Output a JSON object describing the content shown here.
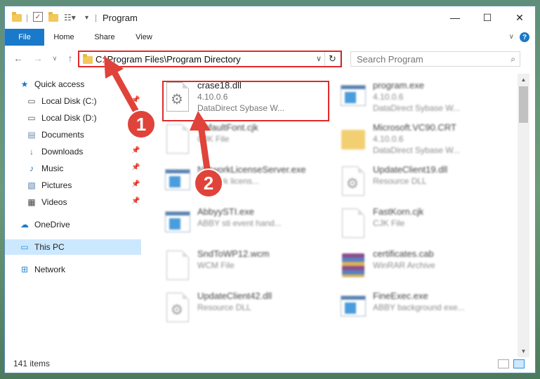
{
  "window": {
    "title": "Program",
    "controls": {
      "minimize": "—",
      "maximize": "☐",
      "close": "✕"
    }
  },
  "ribbon": {
    "tabs": [
      "File",
      "Home",
      "Share",
      "View"
    ],
    "help": "?"
  },
  "address": {
    "path": "C:\\Program Files\\Program Directory"
  },
  "search": {
    "placeholder": "Search Program"
  },
  "sidebar": {
    "items": [
      {
        "label": "Quick access",
        "icon": "star-icon"
      },
      {
        "label": "Local Disk (C:)",
        "icon": "drive-icon",
        "pinned": true
      },
      {
        "label": "Local Disk (D:)",
        "icon": "drive-icon"
      },
      {
        "label": "Documents",
        "icon": "documents-icon",
        "pinned": true
      },
      {
        "label": "Downloads",
        "icon": "download-icon",
        "pinned": true
      },
      {
        "label": "Music",
        "icon": "music-icon",
        "pinned": true
      },
      {
        "label": "Pictures",
        "icon": "pictures-icon",
        "pinned": true
      },
      {
        "label": "Videos",
        "icon": "videos-icon",
        "pinned": true
      },
      {
        "label": "OneDrive",
        "icon": "cloud-icon"
      },
      {
        "label": "This PC",
        "icon": "computer-icon",
        "selected": true
      },
      {
        "label": "Network",
        "icon": "network-icon"
      }
    ]
  },
  "files": [
    {
      "name": "crase18.dll",
      "line2": "4.10.0.6",
      "line3": "DataDirect Sybase W...",
      "icon": "dll-icon",
      "highlighted": true
    },
    {
      "name": "program.exe",
      "line2": "4.10.0.6",
      "line3": "DataDirect Sybase W...",
      "icon": "exe-icon"
    },
    {
      "name": "DefaultFont.cjk",
      "line2": "CJK File",
      "line3": "",
      "icon": "file-icon"
    },
    {
      "name": "Microsoft.VC90.CRT",
      "line2": "4.10.0.6",
      "line3": "DataDirect Sybase W...",
      "icon": "folder-icon"
    },
    {
      "name": "NetworkLicenseServer.exe",
      "line2": "Network licens...",
      "line3": "",
      "icon": "exe-icon"
    },
    {
      "name": "UpdateClient19.dll",
      "line2": "Resource DLL",
      "line3": "",
      "icon": "dll-icon"
    },
    {
      "name": "AbbyySTI.exe",
      "line2": "ABBY sti event hand...",
      "line3": "",
      "icon": "exe-icon"
    },
    {
      "name": "FastKorn.cjk",
      "line2": "CJK File",
      "line3": "",
      "icon": "file-icon"
    },
    {
      "name": "SndToWP12.wcm",
      "line2": "WCM File",
      "line3": "",
      "icon": "file-icon"
    },
    {
      "name": "certificates.cab",
      "line2": "WinRAR Archive",
      "line3": "",
      "icon": "archive-icon"
    },
    {
      "name": "UpdateClient42.dll",
      "line2": "Resource DLL",
      "line3": "",
      "icon": "dll-icon"
    },
    {
      "name": "FineExec.exe",
      "line2": "ABBY background exe...",
      "line3": "",
      "icon": "exe-icon"
    }
  ],
  "status": {
    "count": "141 items"
  },
  "annotations": {
    "badge1": "1",
    "badge2": "2",
    "color": "#e0433a"
  }
}
